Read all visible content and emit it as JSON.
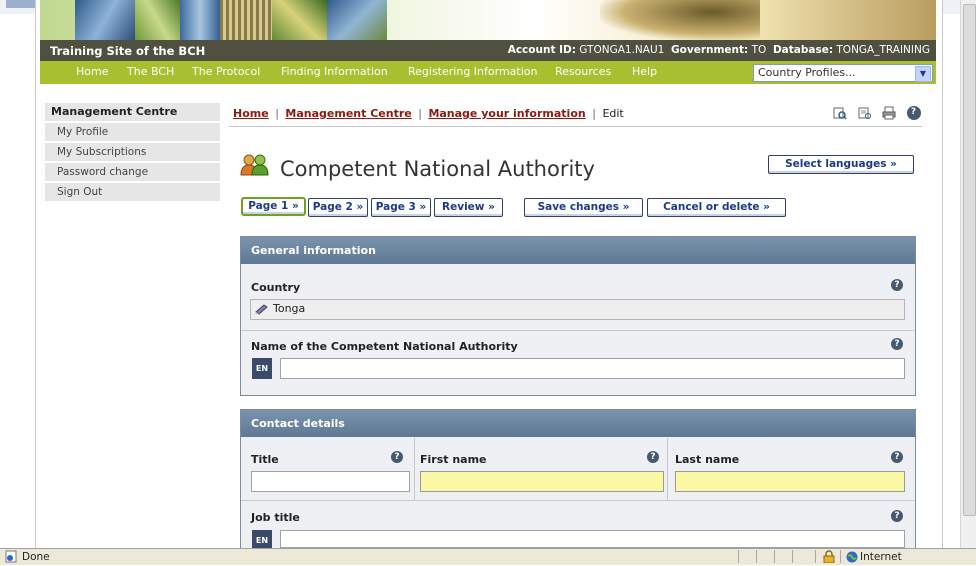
{
  "site": {
    "title": "Training Site of the BCH",
    "account_label": "Account ID:",
    "account_value": "GTONGA1.NAU1",
    "government_label": "Government:",
    "government_value": "TO",
    "database_label": "Database:",
    "database_value": "TONGA_TRAINING"
  },
  "nav": {
    "items": [
      "Home",
      "The BCH",
      "The Protocol",
      "Finding Information",
      "Registering Information",
      "Resources",
      "Help"
    ],
    "country_select": "Country Profiles..."
  },
  "sidebar": {
    "heading": "Management Centre",
    "items": [
      "My Profile",
      "My Subscriptions",
      "Password change",
      "Sign Out"
    ]
  },
  "breadcrumb": {
    "home": "Home",
    "management": "Management Centre",
    "manage": "Manage your information",
    "current": "Edit",
    "separator": "|"
  },
  "page": {
    "title": "Competent National Authority",
    "select_languages": "Select languages »",
    "buttons": [
      "Page 1 »",
      "Page 2 »",
      "Page 3 »",
      "Review »"
    ],
    "save": "Save changes »",
    "cancel": "Cancel or delete »"
  },
  "general": {
    "heading": "General information",
    "country_label": "Country",
    "country_value": "Tonga",
    "name_label": "Name of the Competent National Authority",
    "lang": "EN"
  },
  "contact": {
    "heading": "Contact details",
    "title_label": "Title",
    "first_label": "First name",
    "last_label": "Last name",
    "job_label": "Job title",
    "lang": "EN"
  },
  "status": {
    "text": "Done",
    "zone": "Internet"
  },
  "colors": {
    "nav_green": "#a8c030",
    "site_bar": "#505040",
    "section_head": "#6a84a0",
    "link_red": "#8b1a10",
    "required_yellow": "#fcf9a6"
  },
  "icons": [
    "google-toolbar-icon",
    "print-icon",
    "help-icon",
    "users-icon",
    "lock-icon",
    "globe-icon",
    "ie-page-icon",
    "edit-icon"
  ]
}
